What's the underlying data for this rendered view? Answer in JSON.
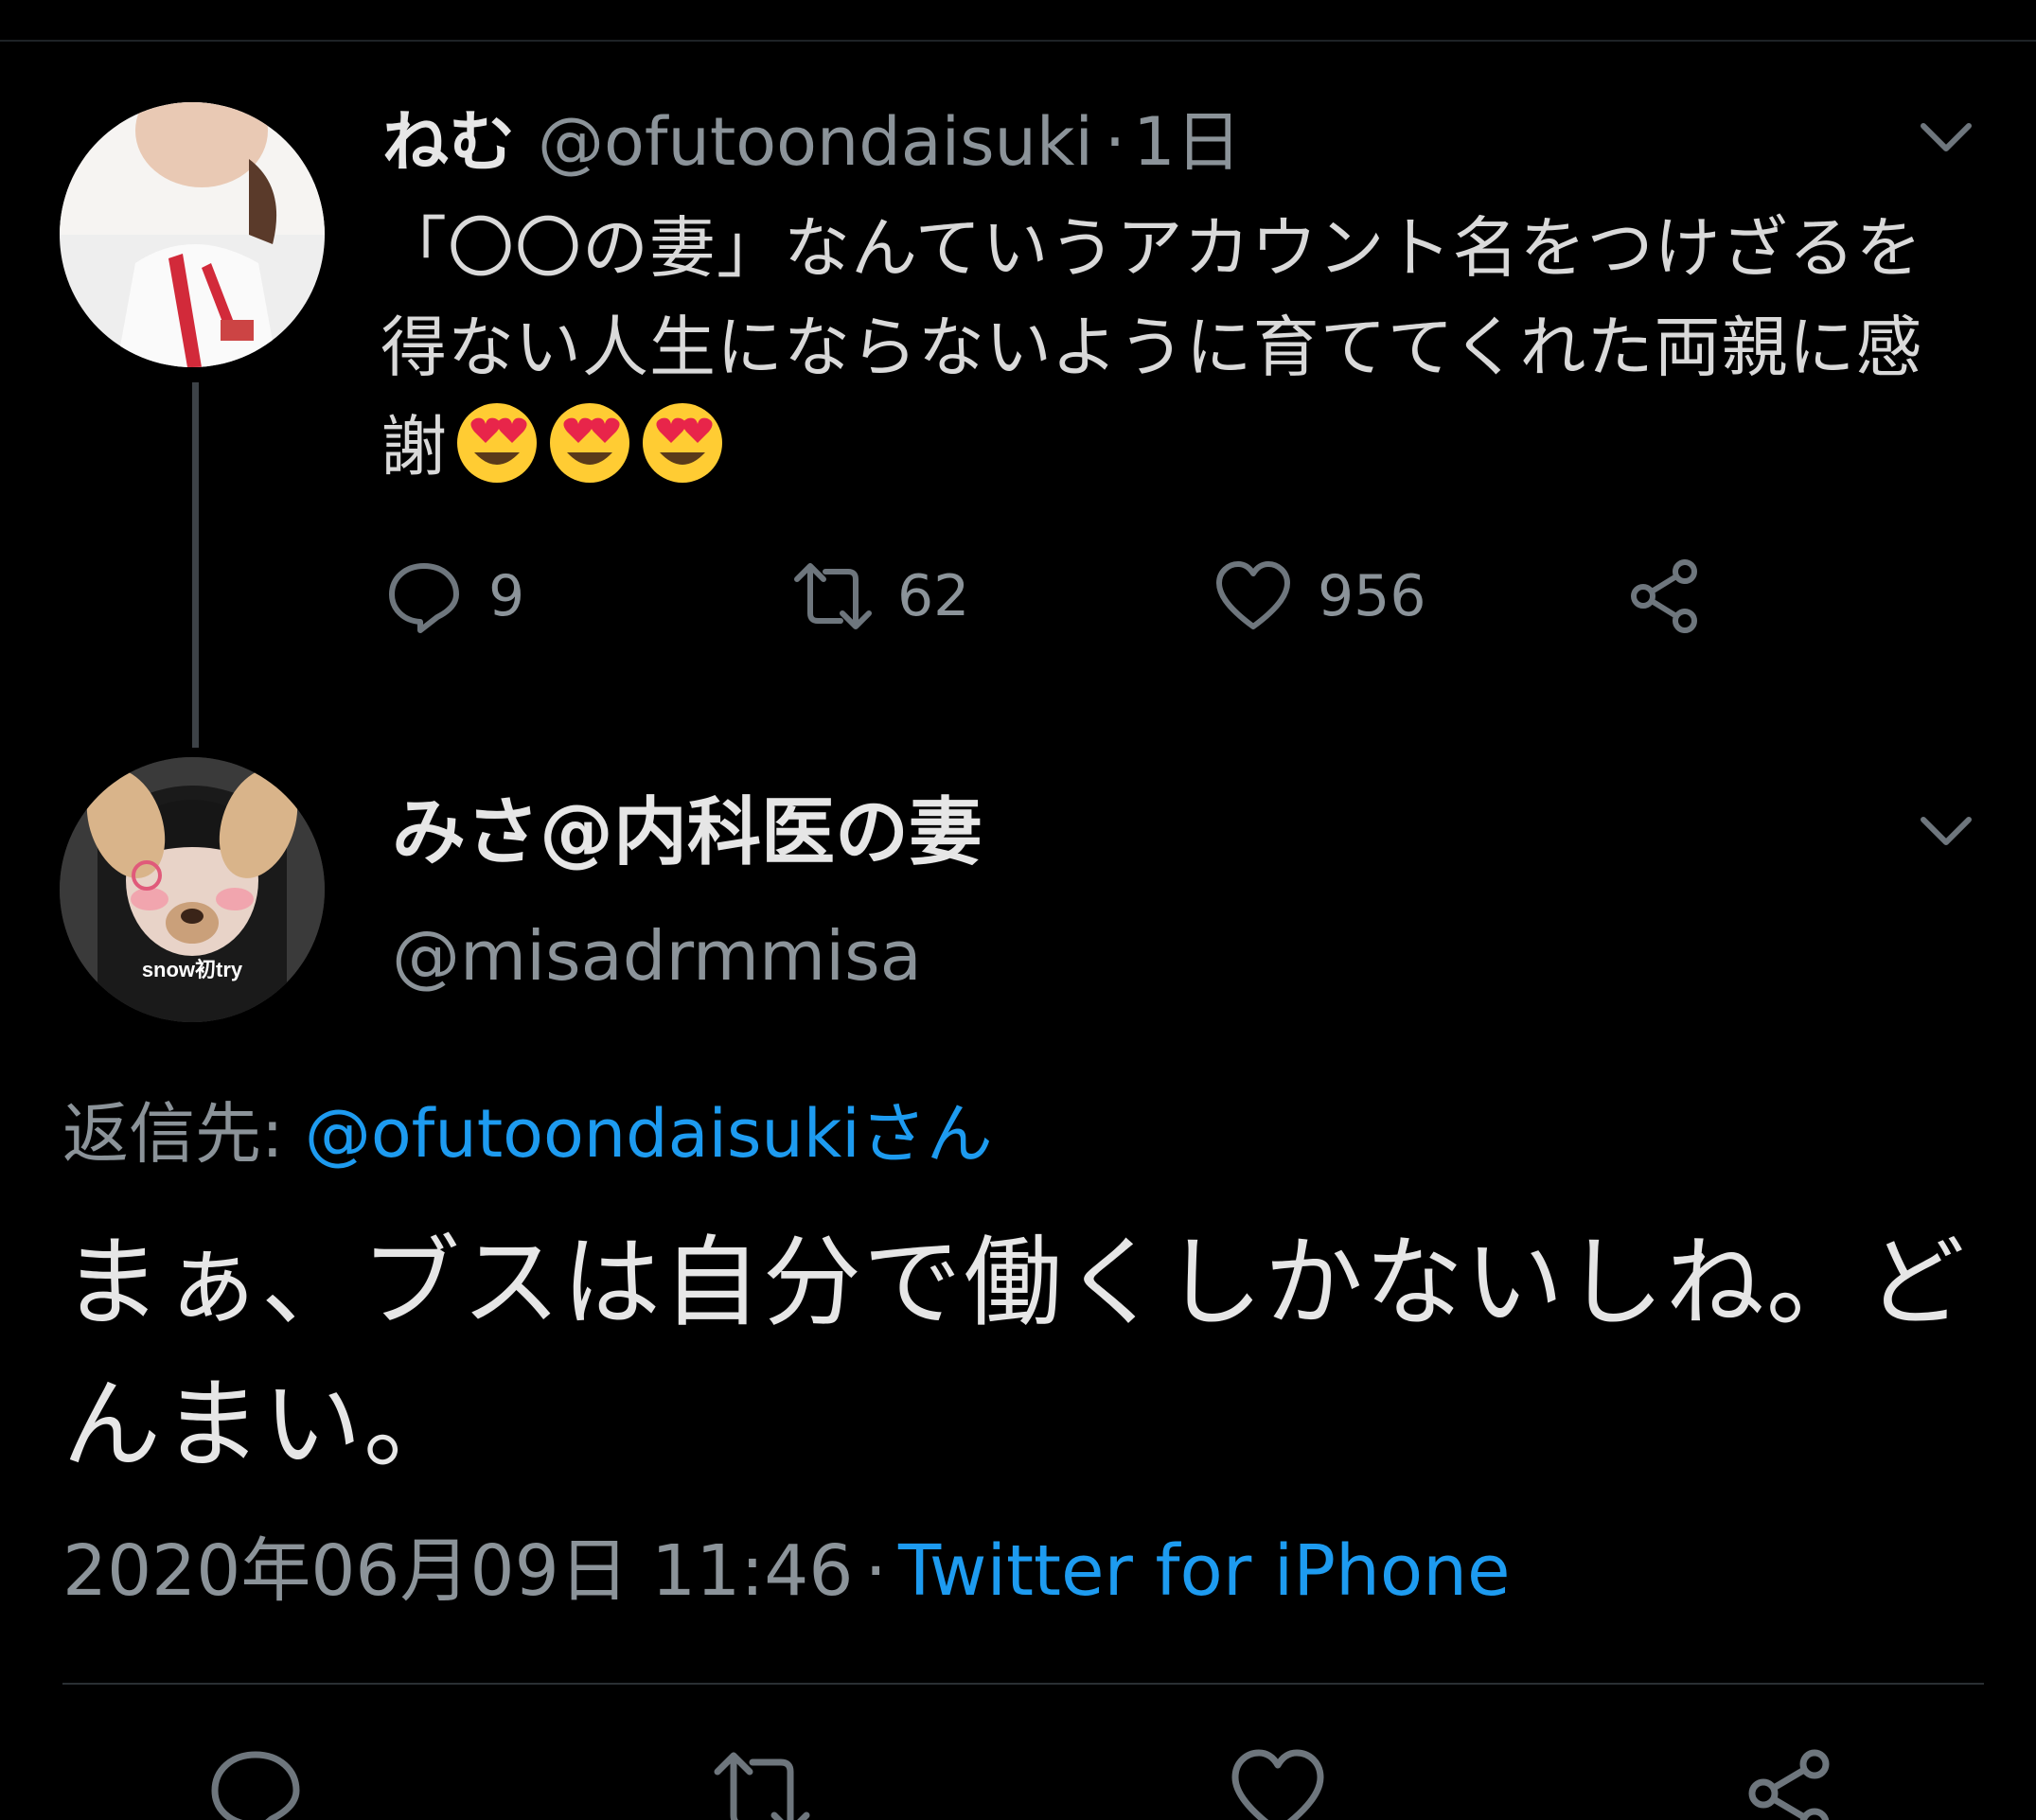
{
  "tweet1": {
    "display_name": "ねむ",
    "handle": "@ofutoondaisuki",
    "separator": "·",
    "time": "1日",
    "text": "「〇〇の妻」なんていうアカウント名をつけざるを得ない人生にならないように育ててくれた両親に感謝",
    "emojis": [
      "heart-eyes-emoji",
      "heart-eyes-emoji",
      "heart-eyes-emoji"
    ],
    "replies": "9",
    "retweets": "62",
    "likes": "956"
  },
  "tweet2": {
    "display_name": "みさ@内科医の妻",
    "handle": "@misadrmmisa",
    "avatar_caption": "snow初try",
    "reply_prefix": "返信先:",
    "reply_target": "@ofutoondaisukiさん",
    "text": "まぁ、ブスは自分で働くしかないしね。どんまい。",
    "timestamp": "2020年06月09日 11:46",
    "separator": "·",
    "client": "Twitter for iPhone"
  },
  "colors": {
    "background": "#000000",
    "text_primary": "#e6e6e6",
    "text_secondary": "#8b9399",
    "link": "#1d9bf0",
    "thread_line": "#3d4247"
  }
}
